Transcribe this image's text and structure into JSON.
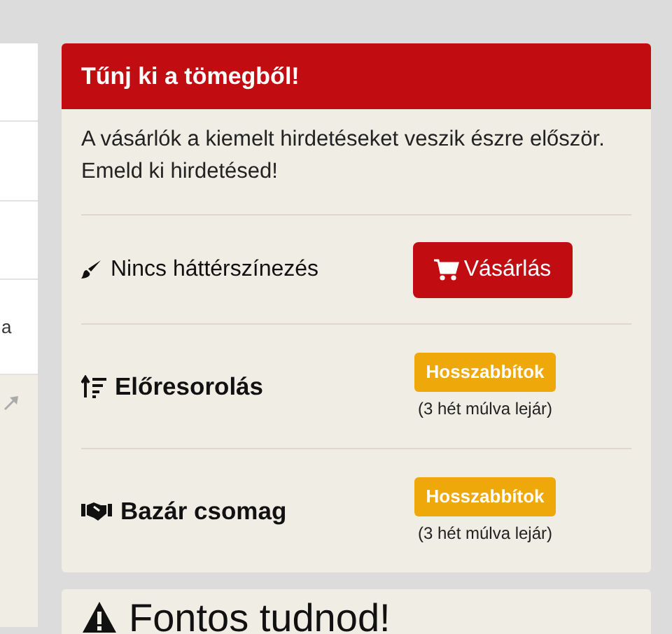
{
  "left_panel": {
    "text": "a"
  },
  "promo_card": {
    "title": "Tűnj ki a tömegből!",
    "description": "A vásárlók a kiemelt hirdetéseket veszik észre először. Emeld ki hirdetésed!",
    "options": [
      {
        "kind": "buy",
        "label": "Nincs háttérszínezés",
        "button": "Vásárlás"
      },
      {
        "kind": "extend",
        "label": "Előresorolás",
        "button": "Hosszabbítok",
        "note": "(3 hét múlva lejár)"
      },
      {
        "kind": "extend",
        "label": "Bazár csomag",
        "button": "Hosszabbítok",
        "note": "(3 hét múlva lejár)"
      }
    ]
  },
  "info_card": {
    "title": "Fontos tudnod!"
  }
}
